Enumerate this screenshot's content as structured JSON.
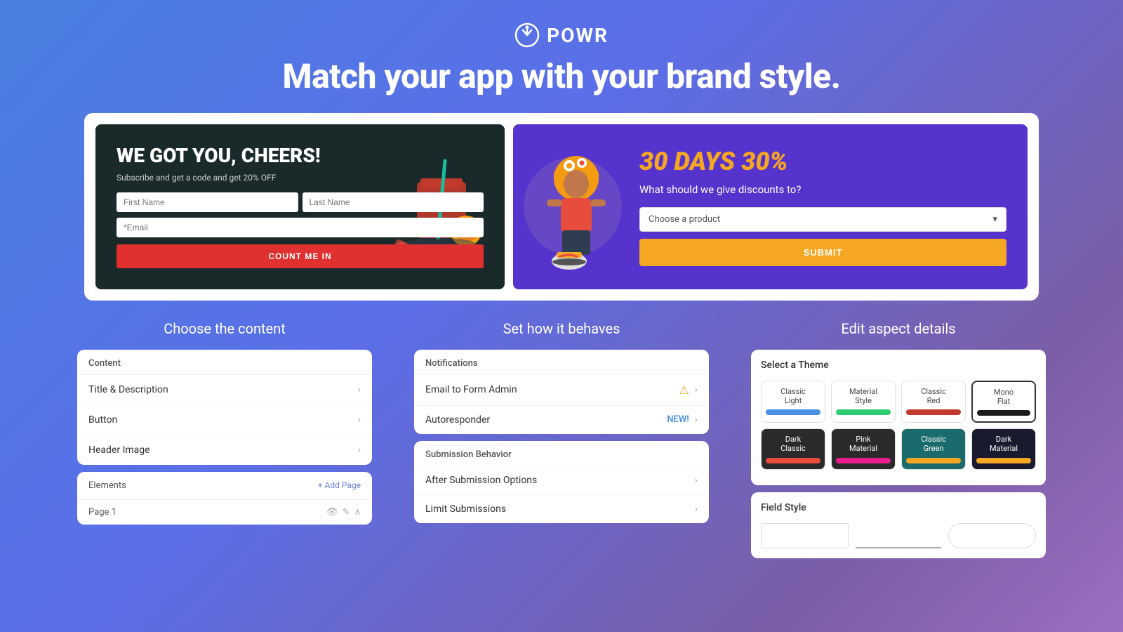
{
  "header": {
    "logo_text": "POWR",
    "headline": "Match your app with your brand style."
  },
  "preview": {
    "left": {
      "title": "WE GOT YOU, CHEERS!",
      "subtitle": "Subscribe and get a code and get 20% OFF",
      "field_first": "First Name",
      "field_last": "Last Name",
      "field_email": "*Email",
      "button_label": "COUNT ME IN"
    },
    "right": {
      "discount_title": "30 DAYS 30%",
      "subtitle": "What should we give discounts to?",
      "select_placeholder": "Choose a product",
      "submit_label": "SUBMIT"
    }
  },
  "choose_content": {
    "section_title": "Choose the content",
    "content_header": "Content",
    "items": [
      {
        "label": "Title & Description"
      },
      {
        "label": "Button"
      },
      {
        "label": "Header Image"
      }
    ],
    "elements_header": "Elements",
    "add_page_label": "+ Add Page",
    "page_item": "Page 1"
  },
  "set_behavior": {
    "section_title": "Set how it behaves",
    "notifications_header": "Notifications",
    "notif_items": [
      {
        "label": "Email to Form Admin",
        "badge": "warning"
      },
      {
        "label": "Autoresponder",
        "badge": "new"
      }
    ],
    "submission_header": "Submission Behavior",
    "submission_items": [
      {
        "label": "After Submission Options"
      },
      {
        "label": "Limit Submissions"
      }
    ]
  },
  "edit_aspect": {
    "section_title": "Edit aspect details",
    "theme_section_title": "Select a Theme",
    "themes": [
      {
        "name": "Classic\nLight",
        "swatch": "#4a90e2",
        "dark": false,
        "selected": false
      },
      {
        "name": "Material\nStyle",
        "swatch": "#2ecc71",
        "dark": false,
        "selected": false
      },
      {
        "name": "Classic\nRed",
        "swatch": "#c0392b",
        "dark": false,
        "selected": false
      },
      {
        "name": "Mono\nFlat",
        "swatch": "#1a1a1a",
        "dark": false,
        "selected": true
      },
      {
        "name": "Dark\nClassic",
        "swatch": "#e74c3c",
        "dark": true,
        "selected": false
      },
      {
        "name": "Pink\nMaterial",
        "swatch": "#e91e8c",
        "dark": true,
        "selected": false
      },
      {
        "name": "Classic\nGreen",
        "swatch": "#f5a623",
        "dark": true,
        "selected": false,
        "teal": true
      },
      {
        "name": "Dark\nMaterial",
        "swatch": "#f5a623",
        "dark": true,
        "selected": false,
        "very_dark": true
      }
    ],
    "field_style_title": "Field Style"
  }
}
